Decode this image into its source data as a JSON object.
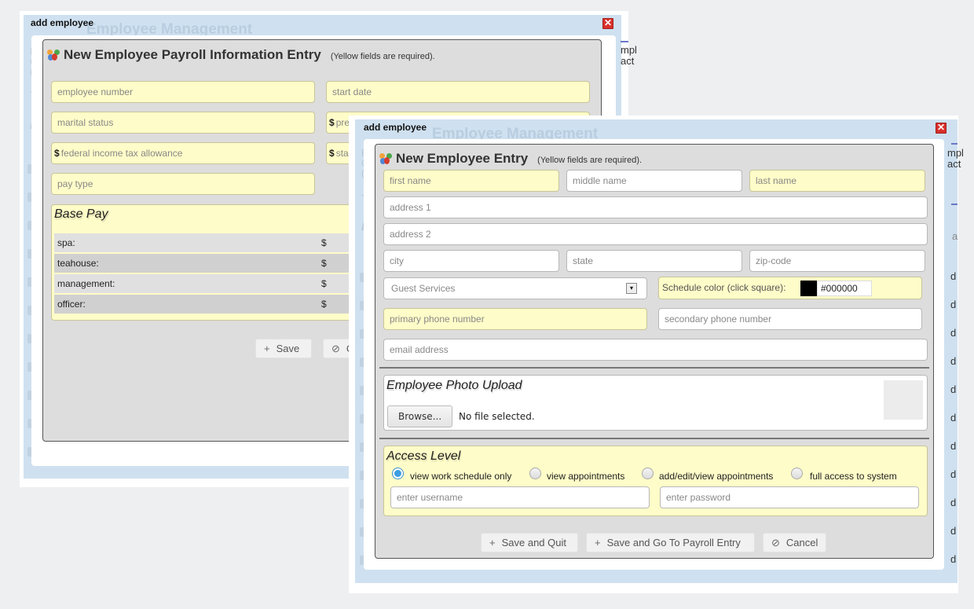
{
  "background_page": {
    "title": "Employee Management",
    "side_letters_top": [
      "B",
      "C",
      "(p"
    ],
    "side_letters_mid": [
      "T"
    ],
    "side_letters_section": [
      "E"
    ],
    "right_text_top": [
      "mpl",
      "act"
    ],
    "right_row_letter": "d",
    "right_header_letter": "a"
  },
  "payroll_dialog": {
    "titlebar": "add employee",
    "header_title": "New Employee Payroll Information Entry",
    "header_note": "(Yellow fields are required).",
    "fields": {
      "employee_number": "employee number",
      "start_date": "start date",
      "marital_status": "marital status",
      "pre_tax": "pre",
      "federal_allowance": "federal income tax allowance",
      "state": "sta",
      "pay_type": "pay type"
    },
    "currency_symbol": "$",
    "base_pay": {
      "legend": "Base Pay",
      "rows": [
        {
          "label": "spa:",
          "currency": "$"
        },
        {
          "label": "teahouse:",
          "currency": "$"
        },
        {
          "label": "management:",
          "currency": "$"
        },
        {
          "label": "officer:",
          "currency": "$"
        }
      ]
    },
    "buttons": {
      "save": "Save",
      "cancel": "C"
    }
  },
  "employee_dialog": {
    "titlebar": "add employee",
    "header_title": "New Employee Entry",
    "header_note": "(Yellow fields are required).",
    "placeholders": {
      "first_name": "first name",
      "middle_name": "middle name",
      "last_name": "last name",
      "address1": "address 1",
      "address2": "address 2",
      "city": "city",
      "state": "state",
      "zip": "zip-code",
      "primary_phone": "primary phone number",
      "secondary_phone": "secondary phone number",
      "email": "email address",
      "username": "enter username",
      "password": "enter password"
    },
    "department_select": {
      "selected": "Guest Services"
    },
    "schedule_color": {
      "label": "Schedule color (click square):",
      "value": "#000000",
      "swatch_color": "#000000"
    },
    "photo_upload": {
      "legend": "Employee Photo Upload",
      "browse_label": "Browse...",
      "file_status": "No file selected."
    },
    "access_level": {
      "legend": "Access Level",
      "options": [
        {
          "label": "view work schedule only",
          "checked": true
        },
        {
          "label": "view appointments",
          "checked": false
        },
        {
          "label": "add/edit/view appointments",
          "checked": false
        },
        {
          "label": "full access to system",
          "checked": false
        }
      ]
    },
    "buttons": {
      "save_quit": "Save and Quit",
      "save_payroll": "Save and Go To Payroll Entry",
      "cancel": "Cancel"
    }
  },
  "icons": {
    "plus": "+",
    "cancel": "⊘",
    "close": "✕",
    "dropdown": "▾"
  },
  "colors": {
    "required_field": "#fefcc8",
    "dialog_frame": "#cfe1f0",
    "radio_checked": "#3d9ee0",
    "close_button": "#d9302b"
  }
}
